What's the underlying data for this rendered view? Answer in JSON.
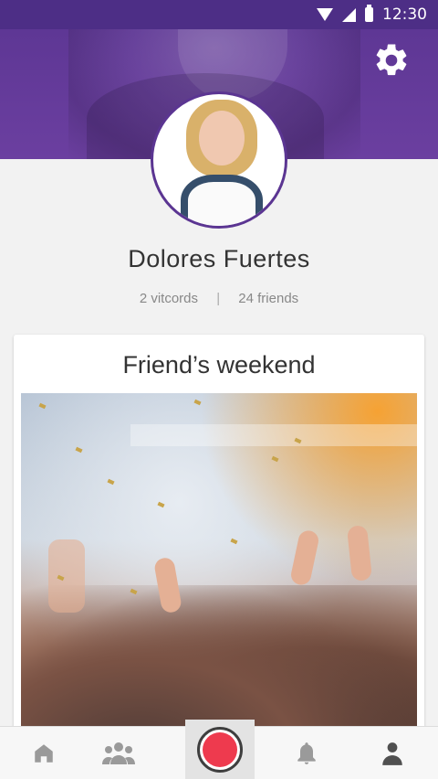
{
  "status_bar": {
    "time": "12:30"
  },
  "profile": {
    "name": "Dolores Fuertes",
    "vitcords": "2 vitcords",
    "separator": "|",
    "friends": "24 friends"
  },
  "card": {
    "title": "Friend’s weekend"
  },
  "bottom_nav": {
    "items": [
      "home-icon",
      "friends-icon",
      "record-button",
      "notifications-icon",
      "profile-icon"
    ]
  },
  "colors": {
    "header_purple": "#5b3592",
    "record_red": "#ee3a4e"
  }
}
